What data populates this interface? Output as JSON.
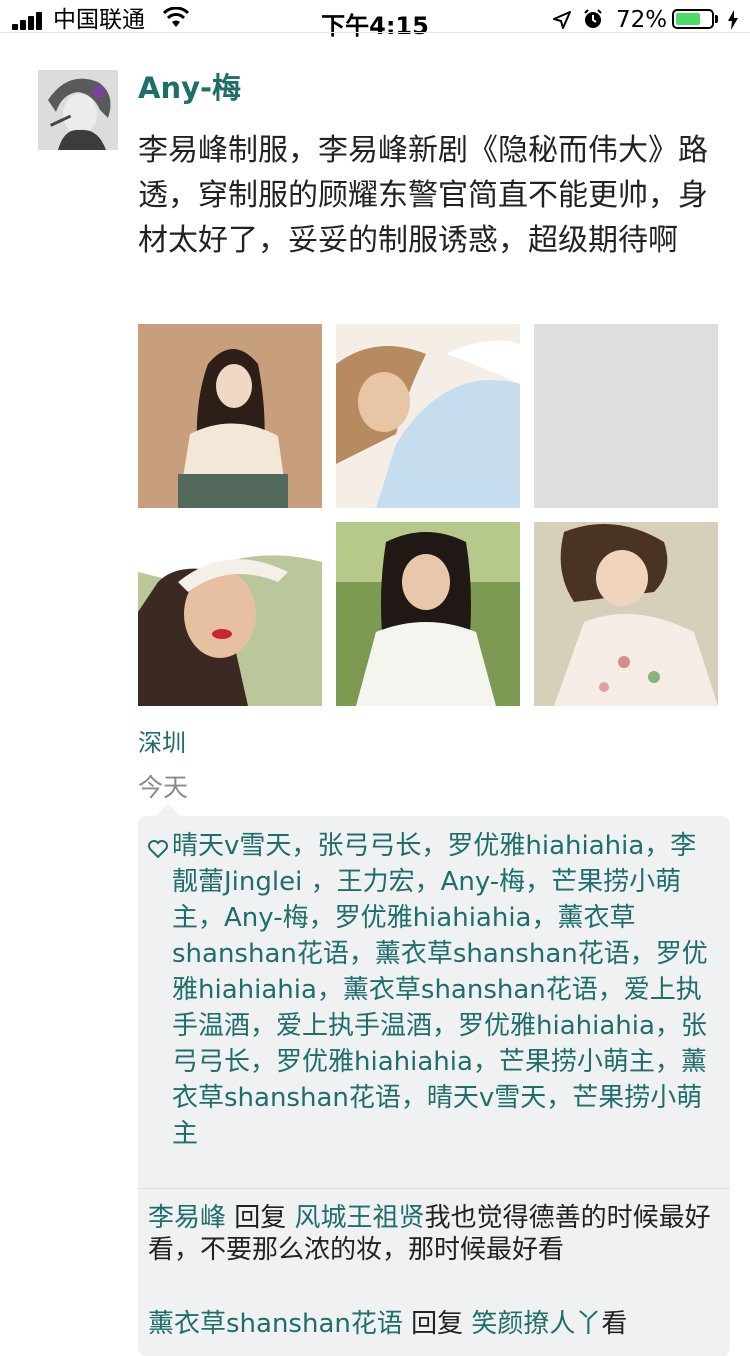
{
  "status_bar": {
    "carrier": "中国联通",
    "time": "下午4:15",
    "battery": "72%",
    "battery_level": 0.72
  },
  "post": {
    "author": "Any-梅",
    "text": "李易峰制服，李易峰新剧《隐秘而伟大》路透，穿制服的顾耀东警官简直不能更帅，身材太好了，妥妥的制服诱惑，超级期待啊",
    "location": "深圳",
    "time": "今天"
  },
  "likes": {
    "names": "晴天v雪天，张弓弓长，罗优雅hiahiahia，李靓蕾Jinglei ，王力宏，Any-梅，芒果捞小萌主，Any-梅，罗优雅hiahiahia，薰衣草shanshan花语，薰衣草shanshan花语，罗优雅hiahiahia，薰衣草shanshan花语，爱上执手温酒，爱上执手温酒，罗优雅hiahiahia，张弓弓长，罗优雅hiahiahia，芒果捞小萌主，薰衣草shanshan花语，晴天v雪天，芒果捞小萌主"
  },
  "comments": [
    {
      "author": "李易峰",
      "reply_word": " 回复 ",
      "target": "风城王祖贤",
      "text": "我也觉得德善的时候最好看，不要那么浓的妆，那时候最好看"
    },
    {
      "author": "薰衣草shanshan花语",
      "reply_word": " 回复 ",
      "target": "笑颜撩人丫",
      "text": "看"
    }
  ],
  "colors": {
    "link": "#1f6e6a",
    "panel_bg": "#f0f1f3"
  }
}
